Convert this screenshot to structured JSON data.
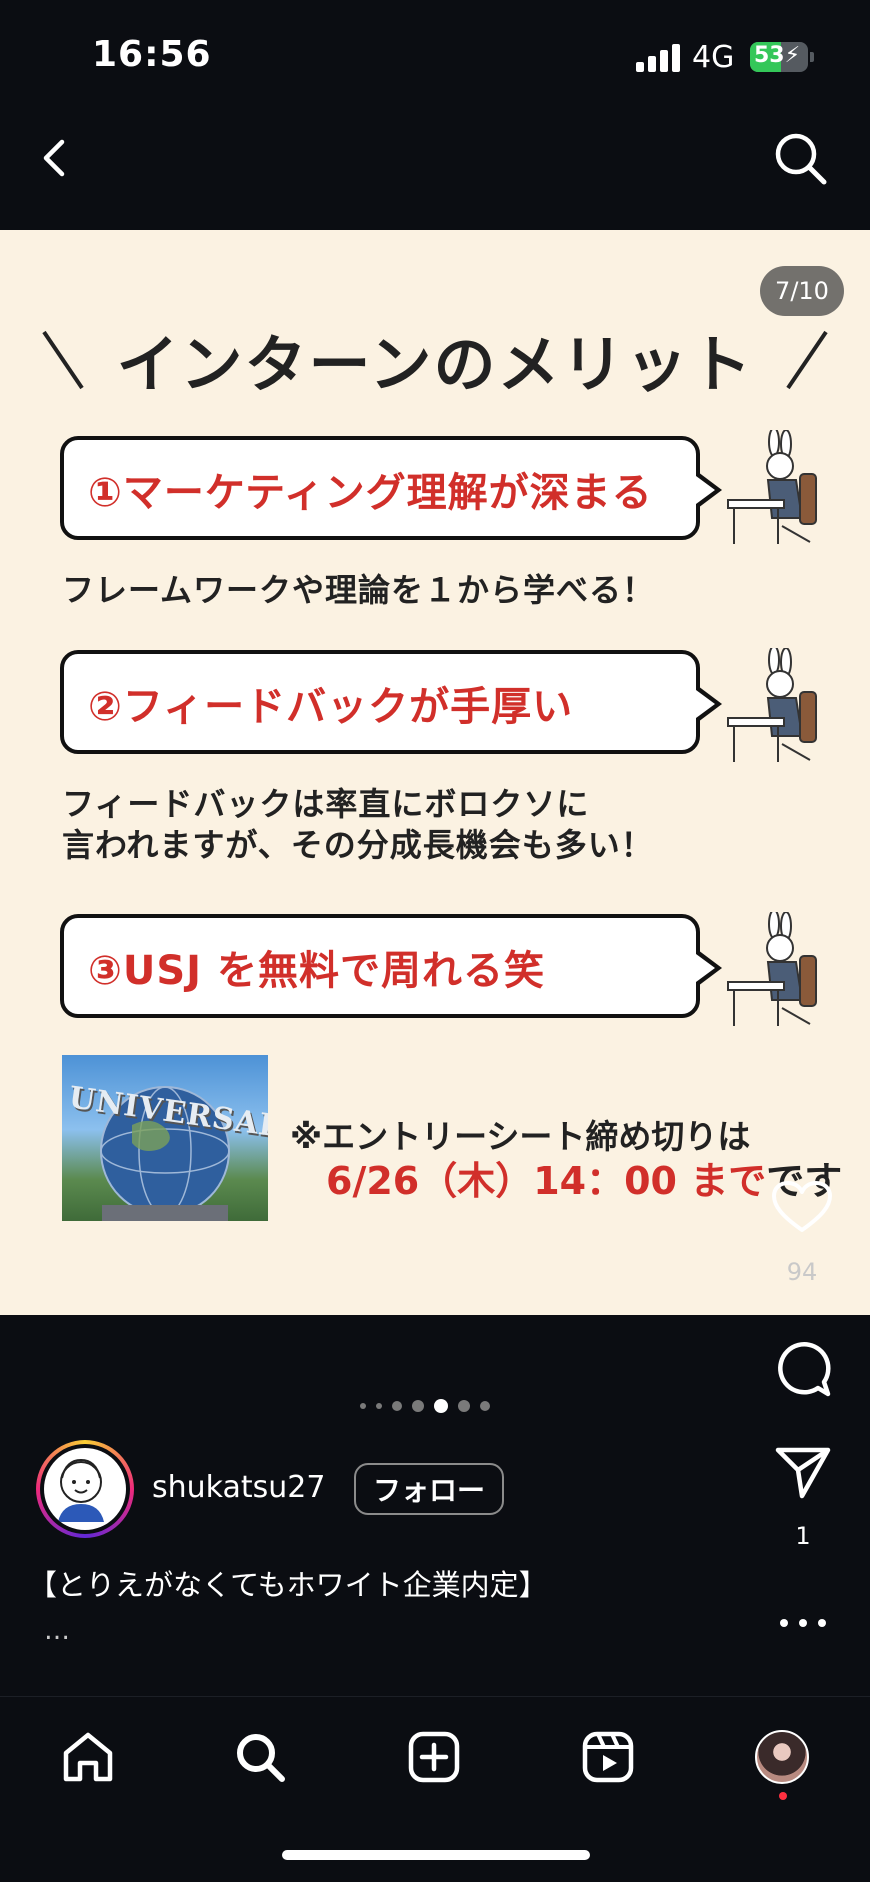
{
  "status_bar": {
    "time": "16:56",
    "network": "4G",
    "battery": "53",
    "battery_level_percent": 53,
    "battery_color": "#34c759"
  },
  "header": {
    "back_icon": "chevron-left-icon",
    "search_icon": "search-icon"
  },
  "post": {
    "page_counter": "7/10",
    "current_page": 7,
    "total_pages": 10,
    "heading": "インターンのメリット",
    "items": [
      {
        "title": "①マーケティング理解が深まる",
        "description": [
          "フレームワークや理論を１から学べる！"
        ]
      },
      {
        "title": "②フィードバックが手厚い",
        "description": [
          "フィードバックは率直にボロクソに",
          "言われますが、その分成長機会も多い！"
        ]
      },
      {
        "title": "③USJ を無料で周れる笑",
        "description": []
      }
    ],
    "usj_logo_text": "UNIVERSAL",
    "entry_note_line1": "※エントリーシート締め切りは",
    "entry_note_deadline": "6/26（木）14：00 まで",
    "entry_note_suffix": "です",
    "accent_color": "#d12f2a",
    "background_color": "#fbf2e2"
  },
  "actions": {
    "like_count": "94",
    "share_count": "1",
    "icons": [
      "heart-icon",
      "comment-icon",
      "send-icon",
      "more-icon"
    ]
  },
  "carousel": {
    "dot_count": 7,
    "active_index": 4
  },
  "author": {
    "username": "shukatsu27",
    "follow_label": "フォロー"
  },
  "caption": {
    "text": "【とりえがなくてもホワイト企業内定】",
    "more": "…"
  },
  "bottom_nav": {
    "items": [
      "home-icon",
      "search-icon",
      "create-icon",
      "reels-icon",
      "profile-avatar"
    ]
  }
}
